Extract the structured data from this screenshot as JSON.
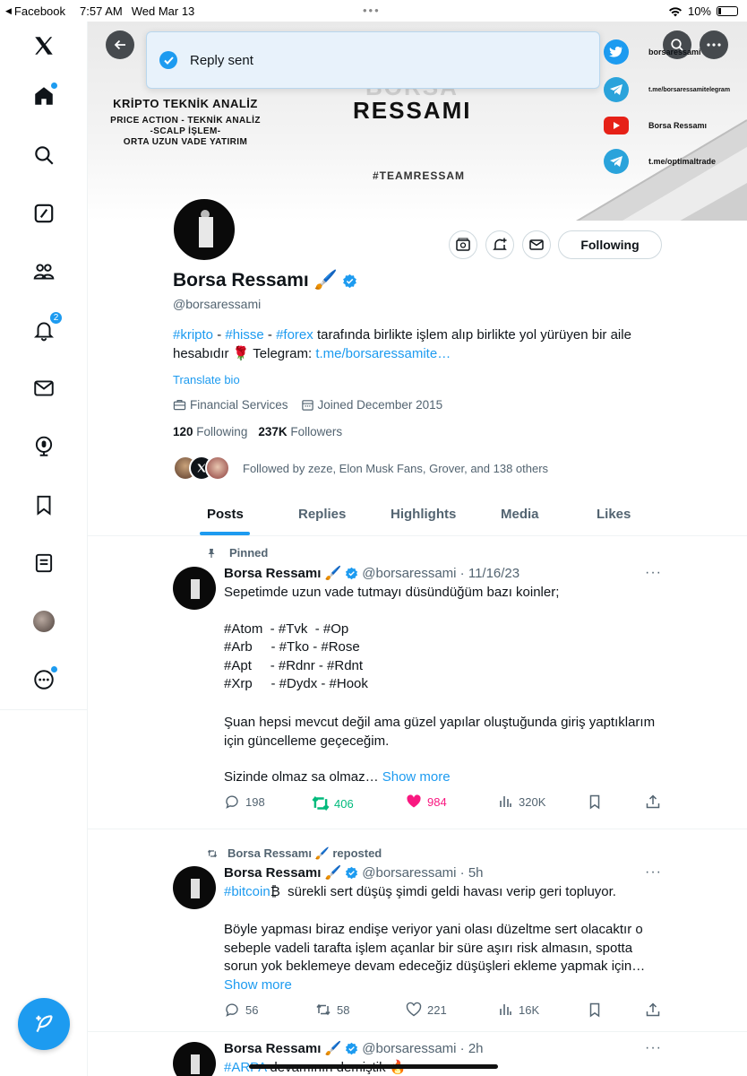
{
  "status_bar": {
    "back_app": "Facebook",
    "time": "7:57 AM",
    "date": "Wed Mar 13",
    "dots": "•••",
    "battery": "10%"
  },
  "sidebar": {
    "notifications_count": "2"
  },
  "toast": {
    "text": "Reply sent"
  },
  "banner": {
    "title": "KRİPTO TEKNİK ANALİZ",
    "subtitle_lines": "PRICE ACTION - TEKNİK ANALİZ\n-SCALP İŞLEM-\nORTA UZUN VADE YATIRIM",
    "brand": "RESSAMI",
    "brand_ghost": "BORSA",
    "tag": "#TEAMRESSAM",
    "social_twitter": "borsaressami",
    "social_telegram": "t.me/borsaressamitelegram",
    "social_youtube": "Borsa Ressamı",
    "social_telegram2": "t.me/optimaltrade"
  },
  "profile": {
    "name": "Borsa Ressamı 🖌️",
    "handle": "@borsaressami",
    "bio_tag1": "#kripto",
    "bio_sep1": " - ",
    "bio_tag2": "#hisse",
    "bio_sep2": " - ",
    "bio_tag3": "#forex",
    "bio_text": " tarafında birlikte işlem alıp birlikte yol yürüyen bir aile hesabıdır 🌹 Telegram: ",
    "bio_link": "t.me/borsaressamite…",
    "translate": "Translate bio",
    "category": "Financial Services",
    "joined": "Joined December 2015",
    "following_count": "120",
    "following_label": "Following",
    "followers_count": "237K",
    "followers_label": "Followers",
    "followed_by": "Followed by zeze, Elon Musk Fans, Grover, and 138 others",
    "following_button": "Following"
  },
  "tabs": [
    "Posts",
    "Replies",
    "Highlights",
    "Media",
    "Likes"
  ],
  "tweets": [
    {
      "context": "Pinned",
      "name": "Borsa Ressamı 🖌️",
      "handle_time": "@borsaressami · 11/16/23",
      "text": "Sepetimde uzun vade tutmayı düsündüğüm bazı koinler;",
      "tags_row1": "#Atom  - #Tvk  - #Op",
      "tags_row2": "#Arb     - #Tko - #Rose",
      "tags_row3": "#Apt     - #Rdnr - #Rdnt",
      "tags_row4": "#Xrp     - #Dydx - #Hook",
      "text2": "Şuan hepsi mevcut değil ama güzel yapılar oluştuğunda giriş yaptıklarım için güncelleme geçeceğim.",
      "text3": "Sizinde olmaz sa olmaz… ",
      "show_more": "Show more",
      "replies": "198",
      "reposts": "406",
      "likes": "984",
      "views": "320K"
    },
    {
      "context": "Borsa Ressamı 🖌️ reposted",
      "name": "Borsa Ressamı 🖌️",
      "handle_time": "@borsaressami · 5h",
      "tag": "#bitcoin",
      "text_after_tag": "₿  sürekli sert düşüş şimdi geldi havası verip geri topluyor.",
      "text2": "Böyle yapması biraz endişe veriyor yani olası düzeltme sert olacaktır o sebeple vadeli tarafta işlem açanlar bir süre aşırı risk almasın, spotta sorun yok beklemeye devam edeceğiz düşüşleri ekleme yapmak için… ",
      "show_more": "Show more",
      "replies": "56",
      "reposts": "58",
      "likes": "221",
      "views": "16K"
    },
    {
      "name": "Borsa Ressamı 🖌️",
      "handle_time": "@borsaressami · 2h",
      "tag": "#ARPA",
      "text_after_tag": " devamının demiştik 🔥"
    }
  ]
}
